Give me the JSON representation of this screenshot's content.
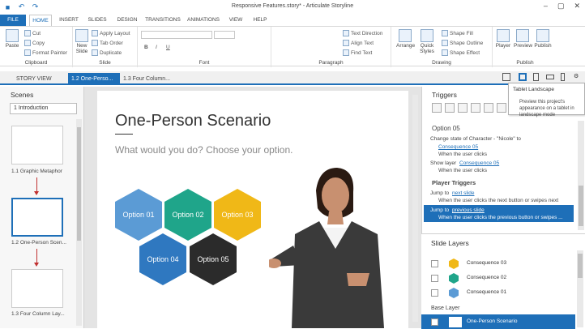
{
  "window": {
    "title": "Responsive Features.story* - Articulate Storyline",
    "minimize": "–",
    "maximize": "▢",
    "close": "✕"
  },
  "quick_access": {
    "save_icon": "save-icon",
    "undo": "↶",
    "redo": "↷"
  },
  "ribbon_tabs": [
    "FILE",
    "HOME",
    "INSERT",
    "SLIDES",
    "DESIGN",
    "TRANSITIONS",
    "ANIMATIONS",
    "VIEW",
    "HELP"
  ],
  "clipboard": {
    "paste": "Paste",
    "cut": "Cut",
    "copy": "Copy",
    "format_painter": "Format Painter",
    "label": "Clipboard"
  },
  "slide_group": {
    "new_slide": "New Slide",
    "apply_layout": "Apply Layout",
    "tab_order": "Tab Order",
    "duplicate": "Duplicate",
    "label": "Slide"
  },
  "font_group": {
    "bold": "B",
    "italic": "I",
    "underline": "U",
    "label": "Font"
  },
  "paragraph_group": {
    "text_direction": "Text Direction",
    "align_text": "Align Text",
    "find_text": "Find Text",
    "label": "Paragraph"
  },
  "drawing_group": {
    "arrange": "Arrange",
    "quick_styles": "Quick Styles",
    "shape_fill": "Shape Fill",
    "shape_outline": "Shape Outline",
    "shape_effect": "Shape Effect",
    "label": "Drawing"
  },
  "publish_group": {
    "player": "Player",
    "preview": "Preview",
    "publish": "Publish",
    "label": "Publish"
  },
  "doc_tabs": [
    "STORY VIEW",
    "1.2 One-Perso...",
    "1.3 Four Column..."
  ],
  "scenes": {
    "header": "Scenes",
    "selected_scene": "1 Introduction",
    "slides": [
      {
        "label": "1.1 Graphic Metaphor"
      },
      {
        "label": "1.2 One-Person Scen..."
      },
      {
        "label": "1.3 Four Column Lay..."
      }
    ]
  },
  "slide": {
    "title": "One-Person Scenario",
    "subtitle": "What would you do? Choose your option.",
    "options": [
      "Option 01",
      "Option 02",
      "Option 03",
      "Option 04",
      "Option 05"
    ]
  },
  "colors": {
    "accent": "#1e6fb8",
    "opt1": "#5b9bd5",
    "opt2": "#1fa58a",
    "opt3": "#f0b817",
    "opt4": "#2f78c0",
    "opt5": "#2b2b2b"
  },
  "triggers": {
    "header": "Triggers",
    "option_title": "Option 05",
    "t1_line1": "Change state of Character - \"Nicole\" to",
    "t1_link": "Consequence 05",
    "t1_when": "When the user clicks",
    "t2_line1": "Show layer",
    "t2_link": "Consequence 05",
    "t2_when": "When the user clicks",
    "player_triggers": "Player Triggers",
    "p1_line1": "Jump to",
    "p1_link": "next slide",
    "p1_when": "When the user clicks the next button or swipes next",
    "p2_line1": "Jump to",
    "p2_link": "previous slide",
    "p2_when": "When the user clicks the previous button or swipes ..."
  },
  "layers": {
    "header": "Slide Layers",
    "items": [
      "Consequence 03",
      "Consequence 02",
      "Consequence 01"
    ],
    "base_header": "Base Layer",
    "base": "One-Person Scenario"
  },
  "tooltip": {
    "title": "Tablet Landscape",
    "desc": "Preview this project's appearance on a tablet in landscape mode"
  }
}
